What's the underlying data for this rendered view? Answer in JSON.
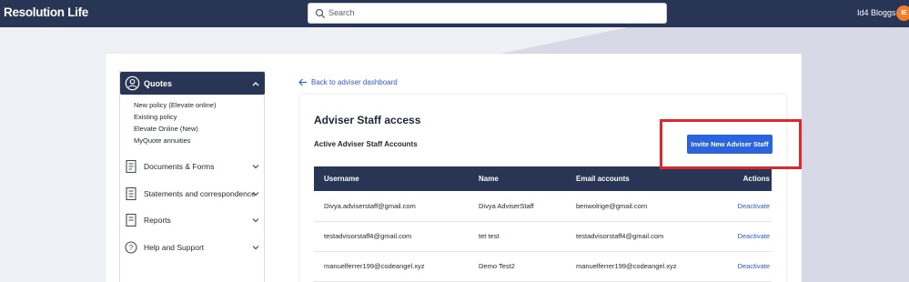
{
  "header": {
    "logo_text": "Resolution Life",
    "search_placeholder": "Search",
    "user_name": "Id4 Bloggs",
    "user_initials": "IE"
  },
  "sidebar": {
    "quotes_label": "Quotes",
    "quotes_items": [
      "New policy (Elevate online)",
      "Existing policy",
      "Elevate Online (New)",
      "MyQuote annuities"
    ],
    "nav": [
      {
        "label": "Documents & Forms",
        "icon": "document-icon"
      },
      {
        "label": "Statements and correspondence",
        "icon": "statement-icon"
      },
      {
        "label": "Reports",
        "icon": "report-icon"
      },
      {
        "label": "Help and Support",
        "icon": "help-icon"
      }
    ]
  },
  "main": {
    "back_link": "Back to adviser dashboard",
    "title": "Adviser Staff access",
    "subtitle": "Active Adviser Staff Accounts",
    "invite_button": "Invite New Adviser Staff",
    "table": {
      "headers": [
        "Username",
        "Name",
        "Email accounts",
        "Actions"
      ],
      "rows": [
        {
          "username": "Divya.adviserstaff@gmail.com",
          "name": "Divya AdviserStaff",
          "email": "benwolrige@gmail.com",
          "action": "Deactivate"
        },
        {
          "username": "testadvisorstaff4@gmail.com",
          "name": "tet test",
          "email": "testadvisorstaff4@gmail.com",
          "action": "Deactivate"
        },
        {
          "username": "manuelferrer199@codeangel.xyz",
          "name": "Demo Test2",
          "email": "manuelferrer199@codeangel.xyz",
          "action": "Deactivate"
        }
      ]
    }
  },
  "colors": {
    "navy": "#283554",
    "accent_blue": "#2a64de",
    "avatar_orange": "#f47b2a",
    "highlight_red": "#e4262b"
  }
}
